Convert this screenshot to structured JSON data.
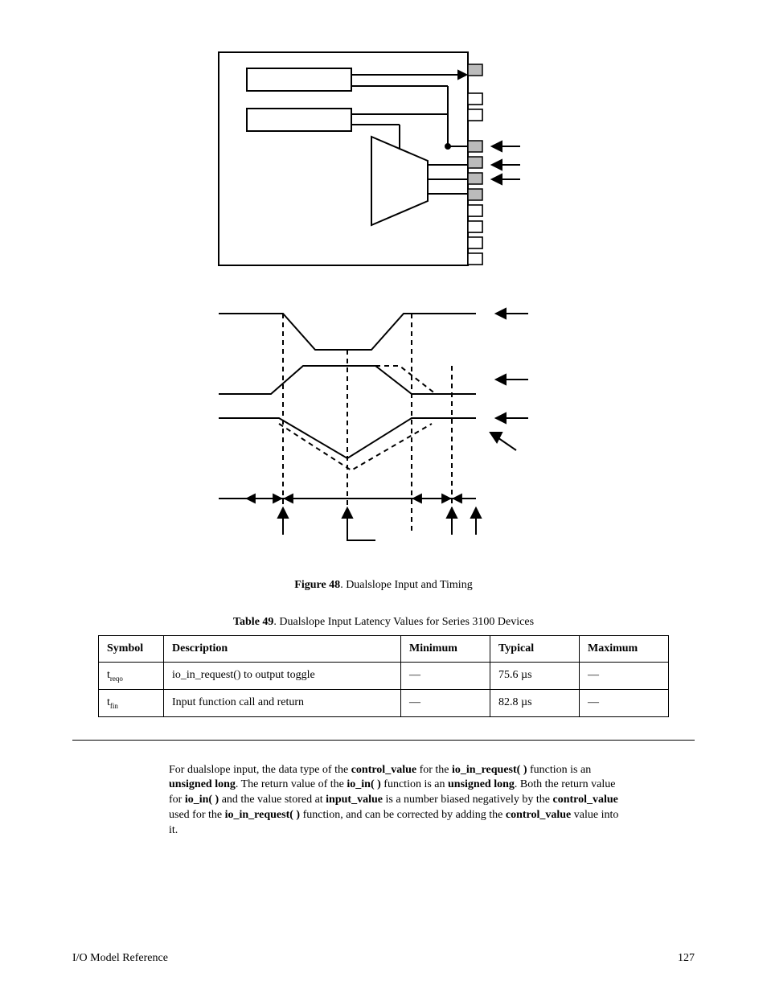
{
  "figure": {
    "label": "Figure 48",
    "caption": ". Dualslope Input and Timing"
  },
  "table": {
    "label": "Table 49",
    "caption": ". Dualslope Input Latency Values for Series 3100 Devices",
    "headers": [
      "Symbol",
      "Description",
      "Minimum",
      "Typical",
      "Maximum"
    ],
    "rows": [
      {
        "symbol_base": "t",
        "symbol_sub": "reqo",
        "desc": "io_in_request() to output toggle",
        "min": "—",
        "typ": "75.6 µs",
        "max": "—"
      },
      {
        "symbol_base": "t",
        "symbol_sub": "fin",
        "desc": "Input function call and return",
        "min": "—",
        "typ": "82.8 µs",
        "max": "—"
      }
    ]
  },
  "paragraph": {
    "p1a": "For dualslope input, the data type of the ",
    "p1b": "control_value",
    "p1c": " for the ",
    "p1d": "io_in_request( )",
    "p1e": " function is an ",
    "p1f": "unsigned long",
    "p1g": ".  The return value of the ",
    "p1h": "io_in( )",
    "p1i": " function is an ",
    "p1j": "unsigned long",
    "p1k": ".  Both the return value for ",
    "p1l": "io_in( )",
    "p1m": " and the value stored at ",
    "p1n": "input_value",
    "p1o": " is a number biased negatively by the ",
    "p1p": "control_value",
    "p1q": " used for the ",
    "p1r": "io_in_request( )",
    "p1s": " function, and can be corrected by adding the ",
    "p1t": "control_value",
    "p1u": " value into it."
  },
  "footer": {
    "left": "I/O Model Reference",
    "right": "127"
  }
}
